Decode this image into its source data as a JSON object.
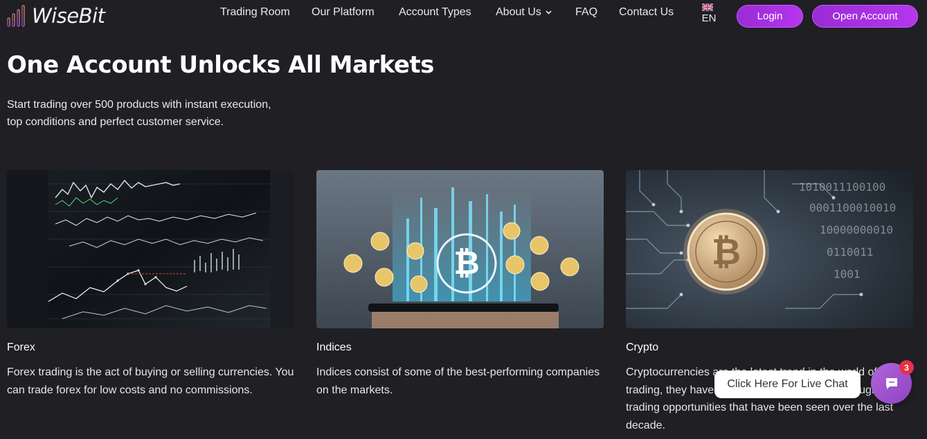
{
  "brand": {
    "name": "WiseBit",
    "accent": "#b536ee"
  },
  "nav": {
    "items": [
      {
        "label": "Trading Room"
      },
      {
        "label": "Our Platform"
      },
      {
        "label": "Account Types"
      },
      {
        "label": "About Us"
      },
      {
        "label": "FAQ"
      },
      {
        "label": "Contact Us"
      }
    ],
    "language": "EN",
    "login_label": "Login",
    "open_account_label": "Open Account"
  },
  "hero": {
    "title": "One Account Unlocks All Markets",
    "subtitle_line1": "Start trading over 500 products with instant execution,",
    "subtitle_line2": "top conditions and perfect customer service."
  },
  "markets": [
    {
      "title": "Forex",
      "text": "Forex trading is the act of buying or selling currencies. You can trade forex for low costs and no commissions.",
      "image_icon": "stock-chart-screens-image"
    },
    {
      "title": "Indices",
      "text": "Indices consist of some of the best-performing companies on the markets.",
      "image_icon": "phone-crypto-hologram-image"
    },
    {
      "title": "Crypto",
      "text": "Cryptocurrencies are the latest trend in the world of trading, they have become some of the most sought-after trading opportunities that have been seen over the last decade.",
      "image_icon": "bitcoin-circuit-image"
    }
  ],
  "chat": {
    "label": "Click Here For Live Chat",
    "badge_count": "3"
  }
}
